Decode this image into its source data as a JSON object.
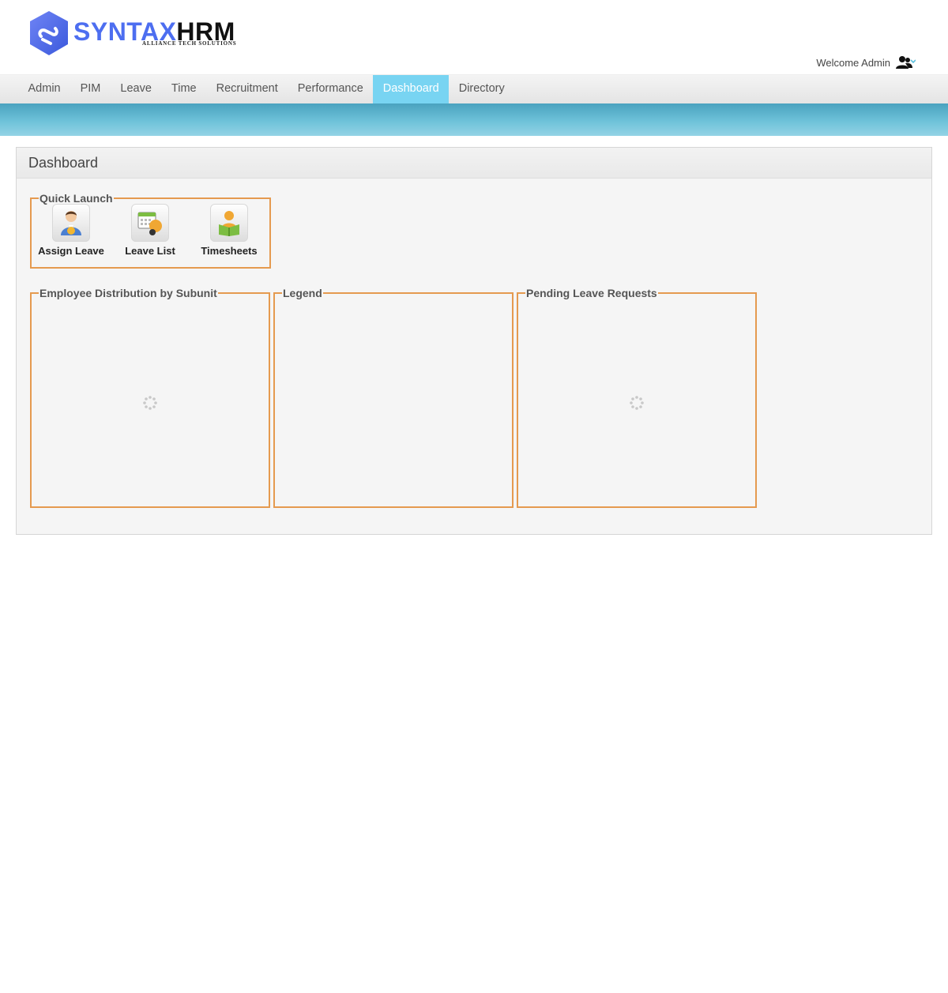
{
  "header": {
    "logo_text_primary": "SYNTAX",
    "logo_text_secondary": "HRM",
    "logo_tagline": "ALLIANCE TECH SOLUTIONS",
    "welcome_text": "Welcome Admin"
  },
  "nav": {
    "items": [
      "Admin",
      "PIM",
      "Leave",
      "Time",
      "Recruitment",
      "Performance",
      "Dashboard",
      "Directory"
    ],
    "active": "Dashboard"
  },
  "dashboard": {
    "title": "Dashboard",
    "quick_launch": {
      "legend": "Quick Launch",
      "items": [
        {
          "label": "Assign Leave",
          "icon": "assign-leave-icon"
        },
        {
          "label": "Leave List",
          "icon": "leave-list-icon"
        },
        {
          "label": "Timesheets",
          "icon": "timesheets-icon"
        }
      ]
    },
    "widgets": {
      "employee_distribution": {
        "legend": "Employee Distribution by Subunit"
      },
      "legend_box": {
        "legend": "Legend"
      },
      "pending_leave": {
        "legend": "Pending Leave Requests"
      }
    }
  },
  "colors": {
    "accent_active_tab": "#78d4f2",
    "fieldset_border": "#e59a4f",
    "logo_blue": "#4d6ef0",
    "banner_strip": "#5fb6d0"
  }
}
